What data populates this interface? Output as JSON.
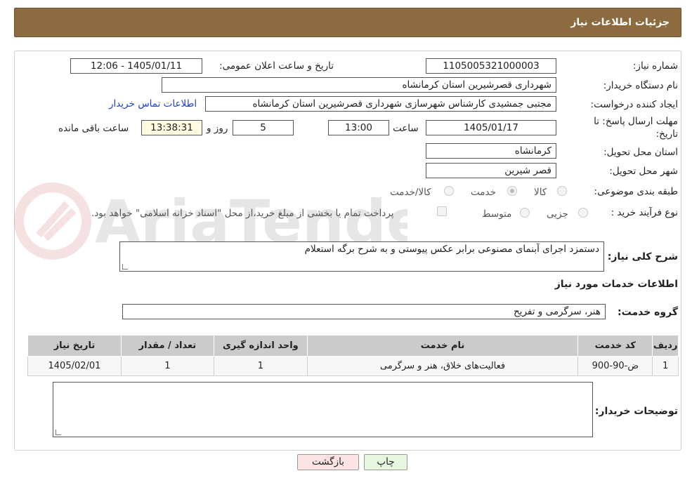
{
  "header": {
    "title": "جزئیات اطلاعات نیاز"
  },
  "form": {
    "need_number_label": "شماره نیاز:",
    "need_number": "1105005321000003",
    "announce_label": "تاریخ و ساعت اعلان عمومی:",
    "announce_value": "1405/01/11 - 12:06",
    "buyer_org_label": "نام دستگاه خریدار:",
    "buyer_org": "شهرداری قصرشیرین استان کرمانشاه",
    "requester_label": "ایجاد کننده درخواست:",
    "requester": "مجتبی جمشیدی کارشناس شهرسازی شهرداری قصرشیرین استان کرمانشاه",
    "contact_link": "اطلاعات تماس خریدار",
    "deadline_label_1": "مهلت ارسال پاسخ: تا",
    "deadline_label_2": "تاریخ:",
    "deadline_date": "1405/01/17",
    "time_label": "ساعت",
    "deadline_time": "13:00",
    "days_value": "5",
    "days_label": "روز و",
    "remaining_time": "13:38:31",
    "remaining_label": "ساعت باقی مانده",
    "province_label": "استان محل تحویل:",
    "province": "کرمانشاه",
    "city_label": "شهر محل تحویل:",
    "city": "قصر شیرین",
    "category_label": "طبقه بندی موضوعی:",
    "category_options": [
      "کالا",
      "خدمت",
      "کالا/خدمت"
    ],
    "category_selected": "خدمت",
    "process_label": "نوع فرآیند خرید :",
    "process_options": [
      "جزیی",
      "متوسط"
    ],
    "payment_note": "پرداخت تمام یا بخشی از مبلغ خرید،از محل \"اسناد خزانه اسلامی\" خواهد بود.",
    "summary_label": "شرح کلی نیاز:",
    "summary": "دستمزد اجرای آبنمای مصنوعی برابر عکس پیوستی و به شرح برگه استعلام",
    "services_heading": "اطلاعات خدمات مورد نیاز",
    "service_group_label": "گروه خدمت:",
    "service_group": "هنر، سرگرمی و تفریح",
    "buyer_notes_label": "توضیحات خریدار:",
    "buyer_notes": ""
  },
  "table": {
    "headers": [
      "ردیف",
      "کد خدمت",
      "نام خدمت",
      "واحد اندازه گیری",
      "تعداد / مقدار",
      "تاریخ نیاز"
    ],
    "rows": [
      [
        "1",
        "ض-90-900",
        "فعالیت‌های خلاق، هنر و سرگرمی",
        "1",
        "1",
        "1405/02/01"
      ]
    ]
  },
  "buttons": {
    "print": "چاپ",
    "back": "بازگشت"
  },
  "watermark": {
    "text": "AriaTender.neT"
  },
  "colors": {
    "header": "#8b6b3f",
    "link": "#1a3fd6",
    "back_button": "#fde4e4",
    "print_button": "#e7f7de"
  }
}
